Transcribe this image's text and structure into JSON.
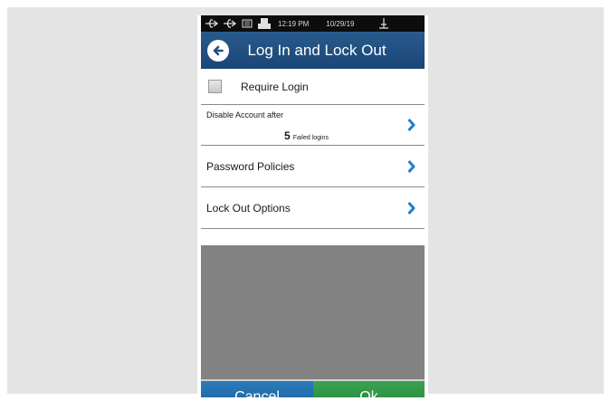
{
  "status_bar": {
    "time": "12:19 PM",
    "date": "10/29/19",
    "icons": [
      "usb-icon",
      "usb-icon",
      "network-icon",
      "printer-icon",
      "antenna-icon"
    ]
  },
  "header": {
    "title": "Log In and Lock Out",
    "back_icon": "back-arrow-icon"
  },
  "settings": {
    "require_login": {
      "label": "Require Login",
      "checked": false
    },
    "disable_account": {
      "label": "Disable Account after",
      "value": "5",
      "unit": "Failed logins"
    },
    "password_policies": {
      "label": "Password Policies"
    },
    "lock_out_options": {
      "label": "Lock Out Options"
    }
  },
  "footer": {
    "cancel_label": "Cancel",
    "ok_label": "Ok"
  },
  "colors": {
    "header": "#1f4f82",
    "cancel": "#1e6aa8",
    "ok": "#2e9145",
    "chevron": "#1e7fd0"
  }
}
